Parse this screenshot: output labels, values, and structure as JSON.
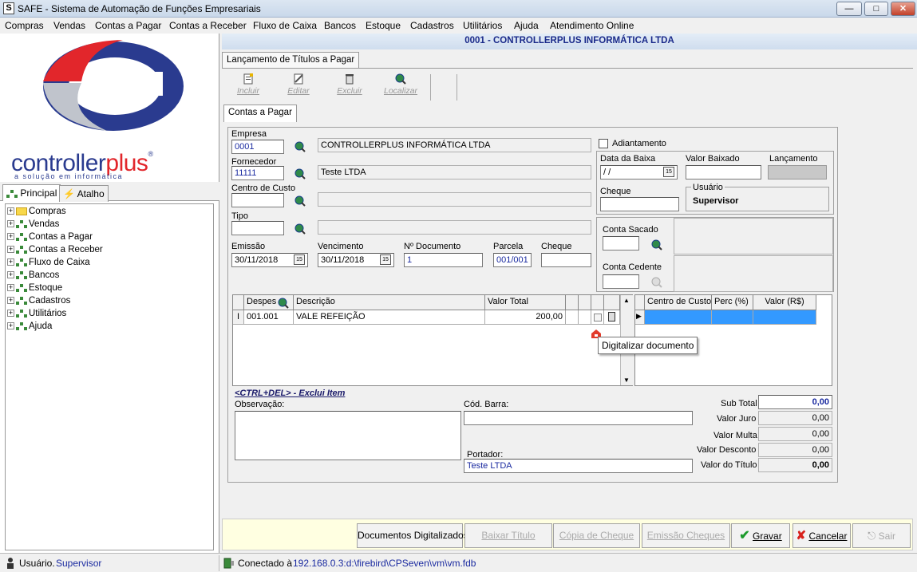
{
  "window": {
    "app_icon": "S",
    "title": "SAFE  -  Sistema de Automação de Funções Empresariais"
  },
  "menu": [
    "Compras",
    "Vendas",
    "Contas a Pagar",
    "Contas a Receber",
    "Fluxo de Caixa",
    "Bancos",
    "Estoque",
    "Cadastros",
    "Utilitários",
    "Ajuda",
    "Atendimento Online"
  ],
  "logo": {
    "brand_main": "controller",
    "brand_accent": "plus",
    "tagline": "a solução em informática",
    "registered": "®"
  },
  "left_tabs": {
    "principal": "Principal",
    "atalho": "Atalho"
  },
  "tree": [
    "Compras",
    "Vendas",
    "Contas a Pagar",
    "Contas a Receber",
    "Fluxo de Caixa",
    "Bancos",
    "Estoque",
    "Cadastros",
    "Utilitários",
    "Ajuda"
  ],
  "company_header": "0001 - CONTROLLERPLUS INFORMÁTICA LTDA",
  "form_tab": "Lançamento de Títulos a Pagar",
  "toolbar": {
    "incluir": "Incluir",
    "editar": "Editar",
    "excluir": "Excluir",
    "localizar": "Localizar"
  },
  "inner_tab": "Contas a Pagar",
  "fields": {
    "empresa_label": "Empresa",
    "empresa_code": "0001",
    "empresa_name": "CONTROLLERPLUS INFORMÁTICA LTDA",
    "fornecedor_label": "Fornecedor",
    "fornecedor_code": "11111",
    "fornecedor_name": "Teste LTDA",
    "centro_label": "Centro de Custo",
    "centro_code": "",
    "centro_name": "",
    "tipo_label": "Tipo",
    "tipo_code": "",
    "tipo_name": "",
    "emissao_label": "Emissão",
    "emissao": "30/11/2018",
    "vencimento_label": "Vencimento",
    "vencimento": "30/11/2018",
    "documento_label": "Nº Documento",
    "documento": "1",
    "parcela_label": "Parcela",
    "parcela": "001/001",
    "cheque_label": "Cheque",
    "cheque": "",
    "calendar_glyph": "15"
  },
  "right_panel": {
    "adiantamento": "Adiantamento",
    "data_baixa_label": "Data da Baixa",
    "data_baixa": " / /",
    "valor_baixado_label": "Valor Baixado",
    "valor_baixado": "",
    "lancamento_label": "Lançamento",
    "cheque_label": "Cheque",
    "cheque": "",
    "usuario_label": "Usuário",
    "usuario": "Supervisor",
    "conta_sacado": "Conta Sacado",
    "conta_cedente": "Conta Cedente"
  },
  "grid": {
    "headers": [
      "Despes",
      "Descrição",
      "Valor Total"
    ],
    "rows": [
      {
        "despesa": "001.001",
        "descricao": "VALE REFEIÇÃO",
        "valor": "200,00"
      }
    ],
    "row_marker": "I"
  },
  "grid_right": {
    "headers": [
      "Centro de Custo",
      "Perc (%)",
      "Valor (R$)"
    ],
    "row_marker": "▶"
  },
  "tooltip": "Digitalizar documento",
  "bottom": {
    "hint": "<CTRL+DEL> - Exclui Item",
    "observacao_label": "Observação:",
    "cod_barra_label": "Cód. Barra:",
    "cod_barra": "",
    "portador_label": "Portador:",
    "portador": "Teste LTDA"
  },
  "totals": {
    "sub_total_label": "Sub Total",
    "sub_total": "0,00",
    "valor_juro_label": "Valor Juro",
    "valor_juro": "0,00",
    "valor_multa_label": "Valor Multa",
    "valor_multa": "0,00",
    "valor_desconto_label": "Valor Desconto",
    "valor_desconto": "0,00",
    "valor_titulo_label": "Valor do Título",
    "valor_titulo": "0,00"
  },
  "buttons": {
    "documentos": "Documentos Digitalizados",
    "baixar": "Baixar Título",
    "copia": "Cópia de Cheque",
    "emissao": "Emissão Cheques",
    "gravar": "Gravar",
    "cancelar": "Cancelar",
    "sair": "Sair"
  },
  "status": {
    "usuario_label": "Usuário.",
    "usuario": "Supervisor",
    "conectado_label": "Conectado à",
    "conexao": "192.168.0.3:d:\\firebird\\CPSeven\\vm\\vm.fdb"
  },
  "colors": {
    "header_text": "#1a2a8a",
    "input_text": "#1a2aa0",
    "selection": "#3399ff",
    "logo_red": "#e2262b",
    "logo_blue": "#2a3b8f",
    "tooltip_bg": "#ffffff",
    "button_bar": "#ffffe1"
  }
}
